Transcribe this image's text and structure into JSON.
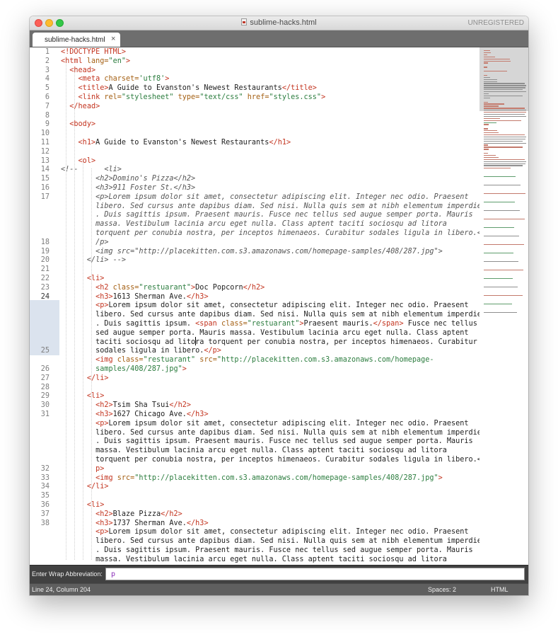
{
  "window": {
    "title": "sublime-hacks.html",
    "registration": "UNREGISTERED"
  },
  "tabs": [
    {
      "label": "sublime-hacks.html",
      "close": "×",
      "active": true
    }
  ],
  "editor": {
    "line_numbers": [
      "1",
      "2",
      "3",
      "4",
      "5",
      "6",
      "7",
      "8",
      "9",
      "10",
      "11",
      "12",
      "13",
      "14",
      "15",
      "16",
      "17",
      "",
      "",
      "",
      "",
      "18",
      "19",
      "20",
      "21",
      "22",
      "23",
      "24",
      "",
      "",
      "",
      "",
      "",
      "25",
      "",
      "26",
      "27",
      "28",
      "29",
      "30",
      "31",
      "",
      "",
      "",
      "",
      "",
      "32",
      "33",
      "34",
      "35",
      "36",
      "37",
      "38",
      "",
      "",
      ""
    ],
    "current_line_row": 27,
    "lines": [
      [
        {
          "c": "t",
          "v": "<!DOCTYPE HTML>"
        }
      ],
      [
        {
          "c": "t",
          "v": "<html"
        },
        {
          "c": "a",
          "v": " lang="
        },
        {
          "c": "s",
          "v": "\"en\""
        },
        {
          "c": "t",
          "v": ">"
        }
      ],
      [
        {
          "c": "",
          "v": "  "
        },
        {
          "c": "t",
          "v": "<head>"
        }
      ],
      [
        {
          "c": "",
          "v": "    "
        },
        {
          "c": "t",
          "v": "<meta"
        },
        {
          "c": "a",
          "v": " charset="
        },
        {
          "c": "s",
          "v": "'utf8'"
        },
        {
          "c": "t",
          "v": ">"
        }
      ],
      [
        {
          "c": "",
          "v": "    "
        },
        {
          "c": "t",
          "v": "<title>"
        },
        {
          "c": "",
          "v": "A Guide to Evanston's Newest Restaurants"
        },
        {
          "c": "t",
          "v": "</title>"
        }
      ],
      [
        {
          "c": "",
          "v": "    "
        },
        {
          "c": "t",
          "v": "<link"
        },
        {
          "c": "a",
          "v": " rel="
        },
        {
          "c": "s",
          "v": "\"stylesheet\""
        },
        {
          "c": "a",
          "v": " type="
        },
        {
          "c": "s",
          "v": "\"text/css\""
        },
        {
          "c": "a",
          "v": " href="
        },
        {
          "c": "s",
          "v": "\"styles.css\""
        },
        {
          "c": "t",
          "v": ">"
        }
      ],
      [
        {
          "c": "",
          "v": "  "
        },
        {
          "c": "t",
          "v": "</head>"
        }
      ],
      [],
      [
        {
          "c": "",
          "v": "  "
        },
        {
          "c": "t",
          "v": "<body>"
        }
      ],
      [],
      [
        {
          "c": "",
          "v": "    "
        },
        {
          "c": "t",
          "v": "<h1>"
        },
        {
          "c": "",
          "v": "A Guide to Evanston's Newest Restaurants"
        },
        {
          "c": "t",
          "v": "</h1>"
        }
      ],
      [],
      [
        {
          "c": "",
          "v": "    "
        },
        {
          "c": "t",
          "v": "<ol>"
        }
      ],
      [
        {
          "c": "cm",
          "v": "<!--      <li>"
        }
      ],
      [
        {
          "c": "cm",
          "v": "        <h2>Domino's Pizza</h2>"
        }
      ],
      [
        {
          "c": "cm",
          "v": "        <h3>911 Foster St.</h3>"
        }
      ],
      [
        {
          "c": "cm",
          "v": "        <p>Lorem ipsum dolor sit amet, consectetur adipiscing elit. Integer nec odio. Praesent"
        }
      ],
      [
        {
          "c": "cm",
          "v": "        libero. Sed cursus ante dapibus diam. Sed nisi. Nulla quis sem at nibh elementum imperdiet"
        }
      ],
      [
        {
          "c": "cm",
          "v": "        . Duis sagittis ipsum. Praesent mauris. Fusce nec tellus sed augue semper porta. Mauris"
        }
      ],
      [
        {
          "c": "cm",
          "v": "        massa. Vestibulum lacinia arcu eget nulla. Class aptent taciti sociosqu ad litora"
        }
      ],
      [
        {
          "c": "cm",
          "v": "        torquent per conubia nostra, per inceptos himenaeos. Curabitur sodales ligula in libero.<"
        }
      ],
      [
        {
          "c": "cm",
          "v": "        /p>"
        }
      ],
      [
        {
          "c": "cm",
          "v": "        <img src=\"http://placekitten.com.s3.amazonaws.com/homepage-samples/408/287.jpg\">"
        }
      ],
      [
        {
          "c": "cm",
          "v": "      </li> -->"
        }
      ],
      [],
      [
        {
          "c": "",
          "v": "      "
        },
        {
          "c": "t",
          "v": "<li>"
        }
      ],
      [
        {
          "c": "",
          "v": "        "
        },
        {
          "c": "t",
          "v": "<h2"
        },
        {
          "c": "a",
          "v": " class="
        },
        {
          "c": "s",
          "v": "\"restuarant\""
        },
        {
          "c": "t",
          "v": ">"
        },
        {
          "c": "",
          "v": "Doc Popcorn"
        },
        {
          "c": "t",
          "v": "</h2>"
        }
      ],
      [
        {
          "c": "",
          "v": "        "
        },
        {
          "c": "t",
          "v": "<h3>"
        },
        {
          "c": "",
          "v": "1613 Sherman Ave."
        },
        {
          "c": "t",
          "v": "</h3>"
        }
      ],
      [
        {
          "c": "",
          "v": "        "
        },
        {
          "c": "t",
          "v": "<p>"
        },
        {
          "c": "",
          "v": "Lorem ipsum dolor sit amet, consectetur adipiscing elit. Integer nec odio. Praesent"
        }
      ],
      [
        {
          "c": "",
          "v": "        libero. Sed cursus ante dapibus diam. Sed nisi. Nulla quis sem at nibh elementum imperdiet"
        }
      ],
      [
        {
          "c": "",
          "v": "        . Duis sagittis ipsum. "
        },
        {
          "c": "t",
          "v": "<span"
        },
        {
          "c": "a",
          "v": " class="
        },
        {
          "c": "s",
          "v": "\"restuarant\""
        },
        {
          "c": "t",
          "v": ">"
        },
        {
          "c": "",
          "v": "Praesent mauris."
        },
        {
          "c": "t",
          "v": "</span>"
        },
        {
          "c": "",
          "v": " Fusce nec tellus"
        }
      ],
      [
        {
          "c": "",
          "v": "        sed augue semper porta. Mauris massa. Vestibulum lacinia arcu eget nulla. Class aptent"
        }
      ],
      [
        {
          "c": "",
          "v": "        taciti sociosqu ad litora torquent per conubia nostra, per inceptos himenaeos. Curabitur"
        }
      ],
      [
        {
          "c": "",
          "v": "        sodales ligula in libero."
        },
        {
          "c": "t",
          "v": "</p>"
        }
      ],
      [
        {
          "c": "",
          "v": "        "
        },
        {
          "c": "t",
          "v": "<img"
        },
        {
          "c": "a",
          "v": " class="
        },
        {
          "c": "s",
          "v": "\"restuarant\""
        },
        {
          "c": "a",
          "v": " src="
        },
        {
          "c": "s",
          "v": "\"http://placekitten.com.s3.amazonaws.com/homepage-"
        }
      ],
      [
        {
          "c": "s",
          "v": "        samples/408/287.jpg\""
        },
        {
          "c": "t",
          "v": ">"
        }
      ],
      [
        {
          "c": "",
          "v": "      "
        },
        {
          "c": "t",
          "v": "</li>"
        }
      ],
      [],
      [
        {
          "c": "",
          "v": "      "
        },
        {
          "c": "t",
          "v": "<li>"
        }
      ],
      [
        {
          "c": "",
          "v": "        "
        },
        {
          "c": "t",
          "v": "<h2>"
        },
        {
          "c": "",
          "v": "Tsim Sha Tsui"
        },
        {
          "c": "t",
          "v": "</h2>"
        }
      ],
      [
        {
          "c": "",
          "v": "        "
        },
        {
          "c": "t",
          "v": "<h3>"
        },
        {
          "c": "",
          "v": "1627 Chicago Ave."
        },
        {
          "c": "t",
          "v": "</h3>"
        }
      ],
      [
        {
          "c": "",
          "v": "        "
        },
        {
          "c": "t",
          "v": "<p>"
        },
        {
          "c": "",
          "v": "Lorem ipsum dolor sit amet, consectetur adipiscing elit. Integer nec odio. Praesent"
        }
      ],
      [
        {
          "c": "",
          "v": "        libero. Sed cursus ante dapibus diam. Sed nisi. Nulla quis sem at nibh elementum imperdiet"
        }
      ],
      [
        {
          "c": "",
          "v": "        . Duis sagittis ipsum. Praesent mauris. Fusce nec tellus sed augue semper porta. Mauris"
        }
      ],
      [
        {
          "c": "",
          "v": "        massa. Vestibulum lacinia arcu eget nulla. Class aptent taciti sociosqu ad litora"
        }
      ],
      [
        {
          "c": "",
          "v": "        torquent per conubia nostra, per inceptos himenaeos. Curabitur sodales ligula in libero.</"
        }
      ],
      [
        {
          "c": "t",
          "v": "        p>"
        }
      ],
      [
        {
          "c": "",
          "v": "        "
        },
        {
          "c": "t",
          "v": "<img"
        },
        {
          "c": "a",
          "v": " src="
        },
        {
          "c": "s",
          "v": "\"http://placekitten.com.s3.amazonaws.com/homepage-samples/408/287.jpg\""
        },
        {
          "c": "t",
          "v": ">"
        }
      ],
      [
        {
          "c": "",
          "v": "      "
        },
        {
          "c": "t",
          "v": "</li>"
        }
      ],
      [],
      [
        {
          "c": "",
          "v": "      "
        },
        {
          "c": "t",
          "v": "<li>"
        }
      ],
      [
        {
          "c": "",
          "v": "        "
        },
        {
          "c": "t",
          "v": "<h2>"
        },
        {
          "c": "",
          "v": "Blaze Pizza"
        },
        {
          "c": "t",
          "v": "</h2>"
        }
      ],
      [
        {
          "c": "",
          "v": "        "
        },
        {
          "c": "t",
          "v": "<h3>"
        },
        {
          "c": "",
          "v": "1737 Sherman Ave."
        },
        {
          "c": "t",
          "v": "</h3>"
        }
      ],
      [
        {
          "c": "",
          "v": "        "
        },
        {
          "c": "t",
          "v": "<p>"
        },
        {
          "c": "",
          "v": "Lorem ipsum dolor sit amet, consectetur adipiscing elit. Integer nec odio. Praesent"
        }
      ],
      [
        {
          "c": "",
          "v": "        libero. Sed cursus ante dapibus diam. Sed nisi. Nulla quis sem at nibh elementum imperdiet"
        }
      ],
      [
        {
          "c": "",
          "v": "        . Duis sagittis ipsum. Praesent mauris. Fusce nec tellus sed augue semper porta. Mauris"
        }
      ],
      [
        {
          "c": "",
          "v": "        massa. Vestibulum lacinia arcu eget nulla. Class aptent taciti sociosqu ad litora"
        }
      ]
    ]
  },
  "panel": {
    "label": "Enter Wrap Abbreviation:",
    "input_value": "p"
  },
  "status": {
    "position": "Line 24, Column 204",
    "spaces": "Spaces: 2",
    "syntax": "HTML"
  },
  "icons": {
    "file": "html-file-icon",
    "close": "close-icon"
  },
  "colors": {
    "tag": "#c3341f",
    "attribute": "#a45f12",
    "string": "#2c7d3f",
    "comment": "#555555",
    "close_button": "#fc5f57",
    "minimize_button": "#fdbc2e",
    "zoom_button": "#33c748"
  }
}
